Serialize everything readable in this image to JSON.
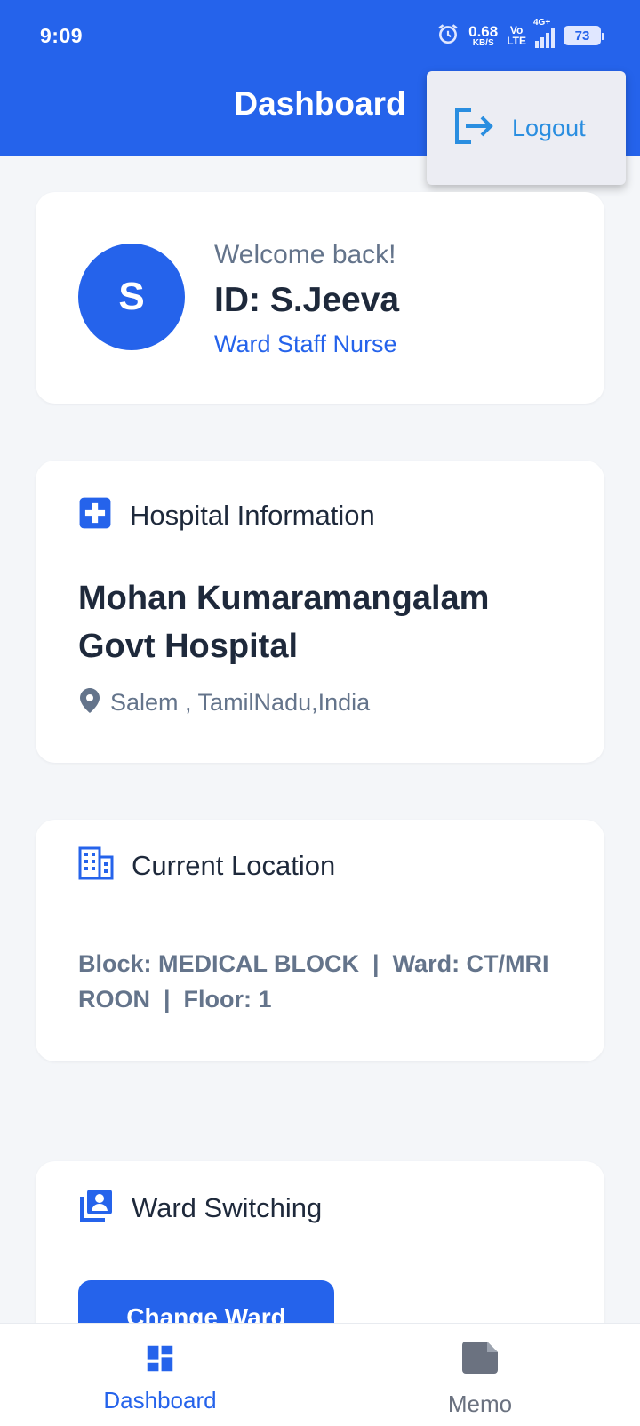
{
  "status_bar": {
    "time": "9:09",
    "net_speed_value": "0.68",
    "net_speed_unit": "KB/S",
    "volte_top": "Vo",
    "volte_bottom": "LTE",
    "network": "4G+",
    "battery": "73"
  },
  "appbar": {
    "title": "Dashboard"
  },
  "popup_menu": {
    "logout_label": "Logout"
  },
  "profile": {
    "avatar_letter": "S",
    "welcome": "Welcome back!",
    "id_label": "ID: S.Jeeva",
    "role": "Ward Staff Nurse"
  },
  "hospital": {
    "heading": "Hospital Information",
    "name": "Mohan Kumaramangalam Govt Hospital",
    "address": "Salem , TamilNadu,India"
  },
  "location": {
    "heading": "Current Location",
    "details": "Block: MEDICAL BLOCK  |  Ward: CT/MRI ROON  |  Floor: 1"
  },
  "ward_switching": {
    "heading": "Ward Switching",
    "button_label": "Change Ward"
  },
  "bottom_nav": {
    "items": [
      {
        "label": "Dashboard",
        "icon": "dashboard-icon",
        "active": true
      },
      {
        "label": "Memo",
        "icon": "memo-icon",
        "active": false
      }
    ]
  },
  "colors": {
    "primary": "#2563eb",
    "logout": "#2a8ee0",
    "muted_text": "#64748b",
    "background": "#f4f6f9"
  }
}
